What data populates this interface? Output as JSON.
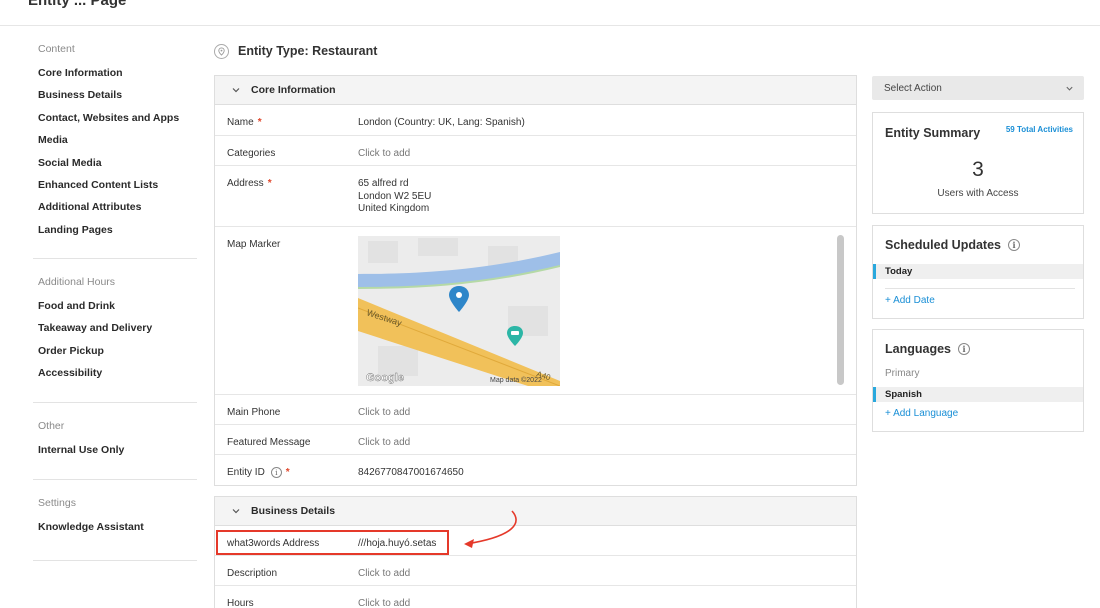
{
  "header": {
    "partial_title": "Entity ... Page"
  },
  "sidebar": {
    "groups": [
      {
        "heading": "Content",
        "items": [
          "Core Information",
          "Business Details",
          "Contact, Websites and Apps",
          "Media",
          "Social Media",
          "Enhanced Content Lists",
          "Additional Attributes",
          "Landing Pages"
        ]
      },
      {
        "heading": "Additional Hours",
        "items": [
          "Food and Drink",
          "Takeaway and Delivery",
          "Order Pickup",
          "Accessibility"
        ]
      },
      {
        "heading": "Other",
        "items": [
          "Internal Use Only"
        ]
      },
      {
        "heading": "Settings",
        "items": [
          "Knowledge Assistant"
        ]
      }
    ]
  },
  "main": {
    "entity_title": "Entity Type: Restaurant",
    "core_info": {
      "heading": "Core Information",
      "name_label": "Name",
      "name_value": "London (Country: UK, Lang: Spanish)",
      "categories_label": "Categories",
      "categories_value": "Click to add",
      "address_label": "Address",
      "address_lines": [
        "65 alfred rd",
        "London W2 5EU",
        "United Kingdom"
      ],
      "map_label": "Map Marker",
      "map_street": "Westway",
      "map_road_end": "A40",
      "map_brand": "Google",
      "map_attribution": "Map data ©2022",
      "phone_label": "Main Phone",
      "phone_value": "Click to add",
      "featured_label": "Featured Message",
      "featured_value": "Click to add",
      "entity_id_label": "Entity ID",
      "entity_id_value": "8426770847001674650"
    },
    "business_details": {
      "heading": "Business Details",
      "w3w_label": "what3words Address",
      "w3w_value": "///hoja.huyó.setas",
      "description_label": "Description",
      "description_value": "Click to add",
      "hours_label": "Hours",
      "hours_value": "Click to add"
    }
  },
  "right": {
    "select_action": "Select Action",
    "summary": {
      "title": "Entity Summary",
      "activities": "59 Total Activities",
      "users_count": "3",
      "users_label": "Users with Access"
    },
    "scheduled": {
      "title": "Scheduled Updates",
      "today": "Today",
      "add_date": "+ Add Date"
    },
    "languages": {
      "title": "Languages",
      "primary_label": "Primary",
      "primary_value": "Spanish",
      "add_language": "+ Add Language"
    }
  },
  "colors": {
    "accent_blue": "#1a8fd6",
    "required_red": "#e0472c",
    "annotation_red": "#e5392a",
    "bar_blue": "#29a8dd"
  },
  "icons": [
    "map-pin-icon",
    "chevron-down-icon",
    "info-icon",
    "curved-arrow-icon"
  ]
}
